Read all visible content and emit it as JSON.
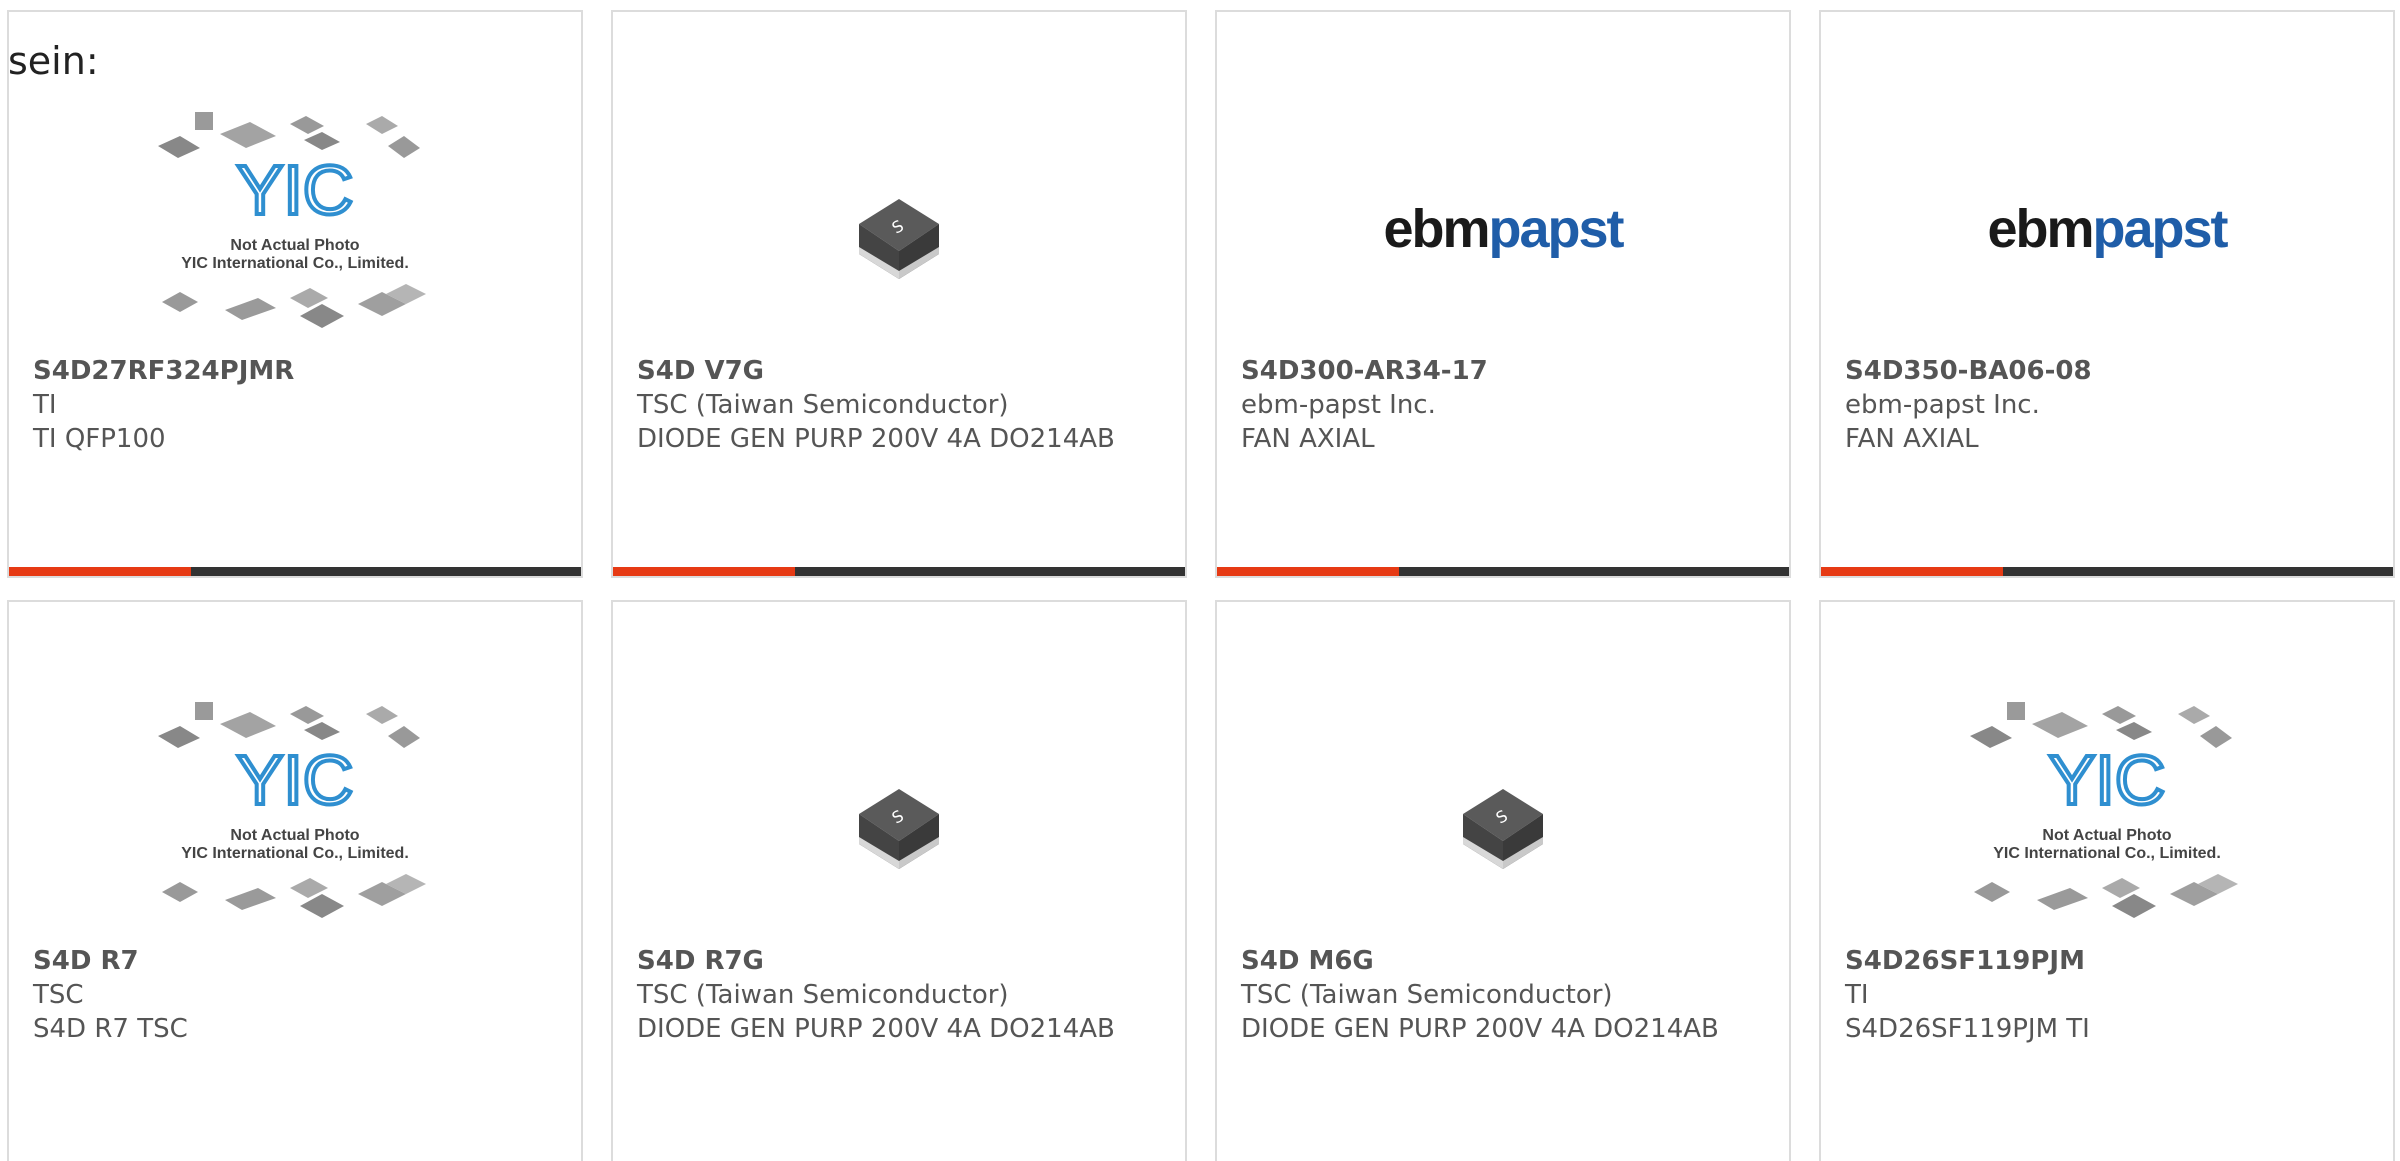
{
  "intro_text": "sein:",
  "cards": [
    {
      "part": "S4D27RF324PJMR",
      "manufacturer": "TI",
      "description": "TI QFP100",
      "image": "yic-placeholder",
      "image_text_1": "Not Actual Photo",
      "image_text_2": "YIC International Co., Limited."
    },
    {
      "part": "S4D V7G",
      "manufacturer": "TSC (Taiwan Semiconductor)",
      "description": "DIODE GEN PURP 200V 4A DO214AB",
      "image": "diode-package"
    },
    {
      "part": "S4D300-AR34-17",
      "manufacturer": "ebm-papst Inc.",
      "description": "FAN AXIAL",
      "image": "ebmpapst-logo",
      "logo_a": "ebm",
      "logo_b": "papst"
    },
    {
      "part": "S4D350-BA06-08",
      "manufacturer": "ebm-papst Inc.",
      "description": "FAN AXIAL",
      "image": "ebmpapst-logo",
      "logo_a": "ebm",
      "logo_b": "papst"
    },
    {
      "part": "S4D R7",
      "manufacturer": "TSC",
      "description": "S4D R7 TSC",
      "image": "yic-placeholder",
      "image_text_1": "Not Actual Photo",
      "image_text_2": "YIC International Co., Limited."
    },
    {
      "part": "S4D R7G",
      "manufacturer": "TSC (Taiwan Semiconductor)",
      "description": "DIODE GEN PURP 200V 4A DO214AB",
      "image": "diode-package"
    },
    {
      "part": "S4D M6G",
      "manufacturer": "TSC (Taiwan Semiconductor)",
      "description": "DIODE GEN PURP 200V 4A DO214AB",
      "image": "diode-package"
    },
    {
      "part": "S4D26SF119PJM",
      "manufacturer": "TI",
      "description": "S4D26SF119PJM TI",
      "image": "yic-placeholder",
      "image_text_1": "Not Actual Photo",
      "image_text_2": "YIC International Co., Limited."
    }
  ],
  "colors": {
    "accent": "#e63a14",
    "bar": "#333333",
    "border": "#dcdcdc",
    "text": "#555555",
    "logo_blue": "#1f5da8",
    "yic_blue": "#2f8fd0"
  }
}
